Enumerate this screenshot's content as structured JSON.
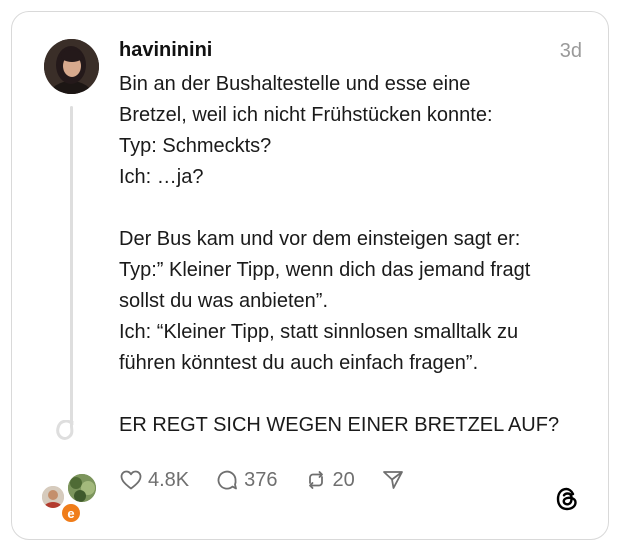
{
  "post": {
    "username": "havininini",
    "time": "3d",
    "lines": [
      "Bin an der Bushaltestelle und esse eine",
      "Bretzel, weil ich nicht Frühstücken konnte:",
      "Typ: Schmeckts?",
      "Ich: …ja?",
      "",
      "Der Bus kam und vor dem einsteigen sagt er:",
      "Typ:” Kleiner Tipp, wenn dich das jemand fragt",
      "sollst du was anbieten”.",
      "Ich: “Kleiner Tipp, statt sinnlosen smalltalk zu",
      "führen könntest du auch einfach fragen”.",
      "",
      "ER REGT SICH WEGEN EINER BRETZEL AUF?"
    ]
  },
  "actions": {
    "likes": "4.8K",
    "comments": "376",
    "reposts": "20",
    "like_icon": "heart-icon",
    "comment_icon": "speech-bubble-icon",
    "repost_icon": "repost-icon",
    "share_icon": "send-icon"
  },
  "repliers": {
    "third_initial": "e"
  },
  "brand": {
    "logo": "threads-logo-icon"
  }
}
